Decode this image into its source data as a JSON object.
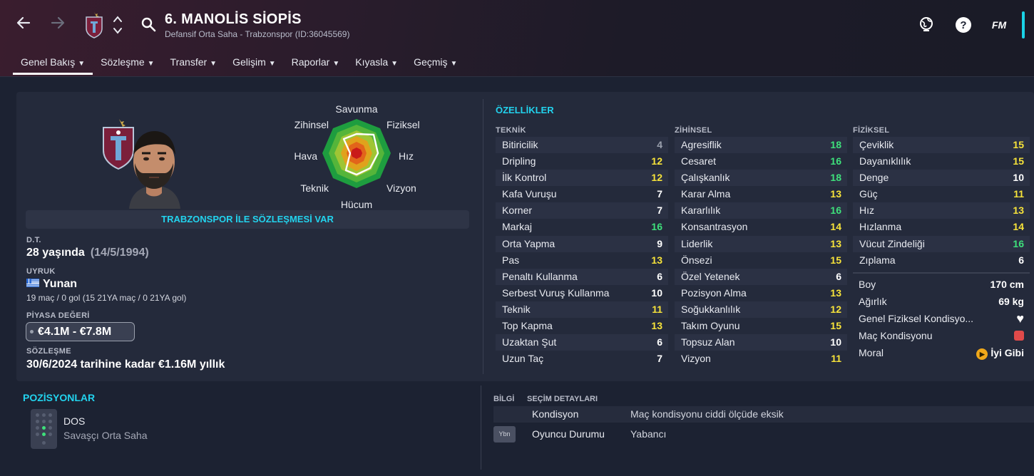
{
  "header": {
    "player_name": "6. MANOLİS SİOPİS",
    "player_subtitle": "Defansif Orta Saha - Trabzonspor (ID:36045569)",
    "logo_text": "FM",
    "tabs": [
      {
        "label": "Genel Bakış",
        "active": true
      },
      {
        "label": "Sözleşme"
      },
      {
        "label": "Transfer"
      },
      {
        "label": "Gelişim"
      },
      {
        "label": "Raporlar"
      },
      {
        "label": "Kıyasla"
      },
      {
        "label": "Geçmiş"
      }
    ],
    "icons": [
      "back-arrow-icon",
      "forward-arrow-icon",
      "club-badge-icon",
      "up-down-icon",
      "search-icon",
      "globe-icon",
      "help-icon"
    ],
    "accent_color": "#1ad3e6"
  },
  "profile": {
    "contract_banner": "TRABZONSPOR İLE SÖZLEŞMESİ VAR",
    "dob_label": "D.T.",
    "age": "28 yaşında",
    "dob": "(14/5/1994)",
    "nationality_label": "UYRUK",
    "nationality": "Yunan",
    "caps": "19 maç / 0 gol (15 21YA maç / 0 21YA gol)",
    "market_value_label": "PİYASA DEĞERİ",
    "market_value": "€4.1M - €7.8M",
    "contract_label": "SÖZLEŞME",
    "contract": "30/6/2024 tarihine kadar €1.16M yıllık"
  },
  "radar": {
    "labels": {
      "top": "Savunma",
      "top_right": "Fiziksel",
      "right": "Hız",
      "bottom_right": "Vizyon",
      "bottom": "Hücum",
      "bottom_left": "Teknik",
      "left": "Hava",
      "top_left": "Zihinsel"
    }
  },
  "attributes": {
    "title": "ÖZELLİKLER",
    "technical": {
      "heading": "TEKNİK",
      "rows": [
        {
          "name": "Bitiricilik",
          "value": "4",
          "tone": "grey"
        },
        {
          "name": "Dripling",
          "value": "12",
          "tone": "yellow"
        },
        {
          "name": "İlk Kontrol",
          "value": "12",
          "tone": "yellow"
        },
        {
          "name": "Kafa Vuruşu",
          "value": "7",
          "tone": "white"
        },
        {
          "name": "Korner",
          "value": "7",
          "tone": "white"
        },
        {
          "name": "Markaj",
          "value": "16",
          "tone": "green"
        },
        {
          "name": "Orta Yapma",
          "value": "9",
          "tone": "white"
        },
        {
          "name": "Pas",
          "value": "13",
          "tone": "yellow"
        },
        {
          "name": "Penaltı Kullanma",
          "value": "6",
          "tone": "white"
        },
        {
          "name": "Serbest Vuruş Kullanma",
          "value": "10",
          "tone": "white"
        },
        {
          "name": "Teknik",
          "value": "11",
          "tone": "yellow"
        },
        {
          "name": "Top Kapma",
          "value": "13",
          "tone": "yellow"
        },
        {
          "name": "Uzaktan Şut",
          "value": "6",
          "tone": "white"
        },
        {
          "name": "Uzun Taç",
          "value": "7",
          "tone": "white"
        }
      ]
    },
    "mental": {
      "heading": "ZİHİNSEL",
      "rows": [
        {
          "name": "Agresiflik",
          "value": "18",
          "tone": "green"
        },
        {
          "name": "Cesaret",
          "value": "16",
          "tone": "green"
        },
        {
          "name": "Çalışkanlık",
          "value": "18",
          "tone": "green"
        },
        {
          "name": "Karar Alma",
          "value": "13",
          "tone": "yellow"
        },
        {
          "name": "Kararlılık",
          "value": "16",
          "tone": "green"
        },
        {
          "name": "Konsantrasyon",
          "value": "14",
          "tone": "yellow"
        },
        {
          "name": "Liderlik",
          "value": "13",
          "tone": "yellow"
        },
        {
          "name": "Önsezi",
          "value": "15",
          "tone": "yellow"
        },
        {
          "name": "Özel Yetenek",
          "value": "6",
          "tone": "white"
        },
        {
          "name": "Pozisyon Alma",
          "value": "13",
          "tone": "yellow"
        },
        {
          "name": "Soğukkanlılık",
          "value": "12",
          "tone": "yellow"
        },
        {
          "name": "Takım Oyunu",
          "value": "15",
          "tone": "yellow"
        },
        {
          "name": "Topsuz Alan",
          "value": "10",
          "tone": "white"
        },
        {
          "name": "Vizyon",
          "value": "11",
          "tone": "yellow"
        }
      ]
    },
    "physical": {
      "heading": "FİZİKSEL",
      "rows": [
        {
          "name": "Çeviklik",
          "value": "15",
          "tone": "yellow"
        },
        {
          "name": "Dayanıklılık",
          "value": "15",
          "tone": "yellow"
        },
        {
          "name": "Denge",
          "value": "10",
          "tone": "white"
        },
        {
          "name": "Güç",
          "value": "11",
          "tone": "yellow"
        },
        {
          "name": "Hız",
          "value": "13",
          "tone": "yellow"
        },
        {
          "name": "Hızlanma",
          "value": "14",
          "tone": "yellow"
        },
        {
          "name": "Vücut Zindeliği",
          "value": "16",
          "tone": "green"
        },
        {
          "name": "Zıplama",
          "value": "6",
          "tone": "white"
        }
      ],
      "height_label": "Boy",
      "height": "170 cm",
      "weight_label": "Ağırlık",
      "weight": "69 kg",
      "fitness_label": "Genel Fiziksel Kondisyo...",
      "match_fitness_label": "Maç Kondisyonu",
      "morale_label": "Moral",
      "morale": "İyi Gibi"
    },
    "colors": {
      "grey": "#9aa0ad",
      "white": "#ffffff",
      "yellow": "#f7e33a",
      "green": "#3ee07b"
    }
  },
  "positions": {
    "title": "POZİSYONLAR",
    "code": "DOS",
    "role": "Savaşçı Orta Saha"
  },
  "details": {
    "info_heading": "BİLGİ",
    "selection_heading": "SEÇİM DETAYLARI",
    "rows": [
      {
        "key": "Kondisyon",
        "value": "Maç kondisyonu ciddi ölçüde eksik",
        "badge": ""
      },
      {
        "key": "Oyuncu Durumu",
        "value": "Yabancı",
        "badge": "Ybn"
      }
    ]
  }
}
